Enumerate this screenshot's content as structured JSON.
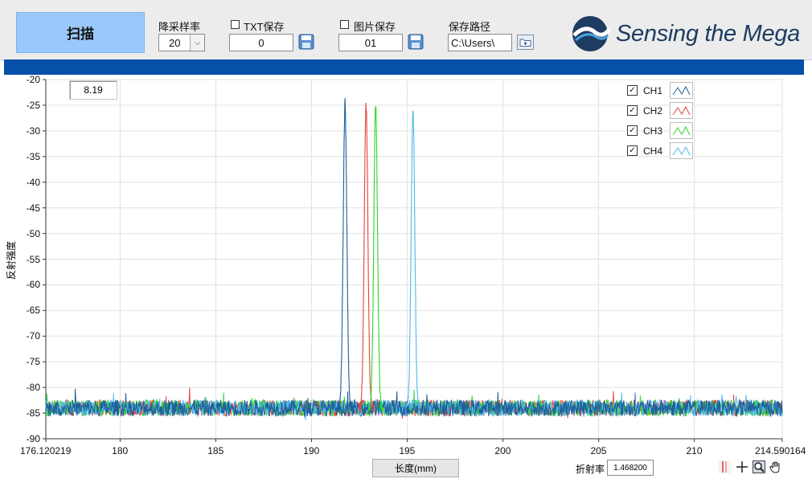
{
  "toolbar": {
    "scan_label": "扫描",
    "downsample_label": "降采样率",
    "downsample_value": "20",
    "txt_save_label": "TXT保存",
    "txt_save_value": "0",
    "img_save_label": "图片保存",
    "img_save_value": "01",
    "path_label": "保存路径",
    "path_value": "C:\\Users\\",
    "logo_text": "Sensing the Mega"
  },
  "colors": {
    "accent_bar": "#0550a8",
    "scan_button": "#9ac8fb",
    "ch1": "#1f5f9a",
    "ch2": "#e8413a",
    "ch3": "#2ad62a",
    "ch4": "#4db8f0"
  },
  "cursor_readout": "8.19",
  "footer": {
    "xlabel": "长度(mm)",
    "refractive_label": "折射率",
    "refractive_value": "1.468200"
  },
  "chart_data": {
    "type": "line",
    "xlabel": "长度(mm)",
    "ylabel": "反射强度",
    "xlim": [
      176.120219,
      214.590164
    ],
    "ylim": [
      -90,
      -20
    ],
    "x_tick_labels": [
      "176.120219",
      "180",
      "185",
      "190",
      "195",
      "200",
      "205",
      "210",
      "214.590164"
    ],
    "x_ticks": [
      176.120219,
      180,
      185,
      190,
      195,
      200,
      205,
      210,
      214.590164
    ],
    "y_ticks": [
      -20,
      -25,
      -30,
      -35,
      -40,
      -45,
      -50,
      -55,
      -60,
      -65,
      -70,
      -75,
      -80,
      -85,
      -90
    ],
    "grid": true,
    "legend_position": "top-right",
    "noise_floor": -84,
    "series": [
      {
        "name": "CH1",
        "peak_x": 191.75,
        "peak_y": -24.5,
        "color": "#1f5f9a"
      },
      {
        "name": "CH2",
        "peak_x": 192.85,
        "peak_y": -25,
        "color": "#e8413a"
      },
      {
        "name": "CH3",
        "peak_x": 193.35,
        "peak_y": -24.2,
        "color": "#2ad62a"
      },
      {
        "name": "CH4",
        "peak_x": 195.3,
        "peak_y": -26.5,
        "color": "#4db8f0"
      }
    ]
  }
}
